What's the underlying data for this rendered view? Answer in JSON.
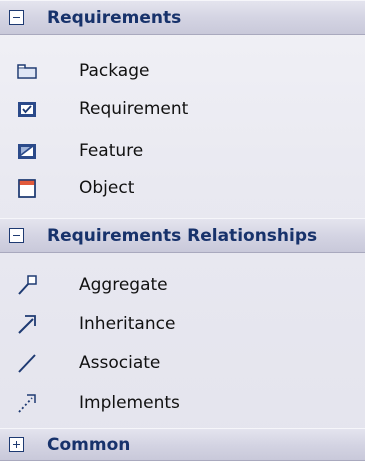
{
  "sections": [
    {
      "title": "Requirements",
      "expanded": true,
      "items": [
        {
          "label": "Package",
          "icon": "package-icon"
        },
        {
          "label": "Requirement",
          "icon": "requirement-icon"
        },
        {
          "label": "Feature",
          "icon": "feature-icon"
        },
        {
          "label": "Object",
          "icon": "object-icon"
        }
      ]
    },
    {
      "title": "Requirements Relationships",
      "expanded": true,
      "items": [
        {
          "label": "Aggregate",
          "icon": "aggregate-icon"
        },
        {
          "label": "Inheritance",
          "icon": "inheritance-icon"
        },
        {
          "label": "Associate",
          "icon": "associate-icon"
        },
        {
          "label": "Implements",
          "icon": "implements-icon"
        }
      ]
    },
    {
      "title": "Common",
      "expanded": false,
      "items": []
    }
  ],
  "colors": {
    "header_text": "#17326b",
    "icon_blue": "#1e3a72"
  }
}
